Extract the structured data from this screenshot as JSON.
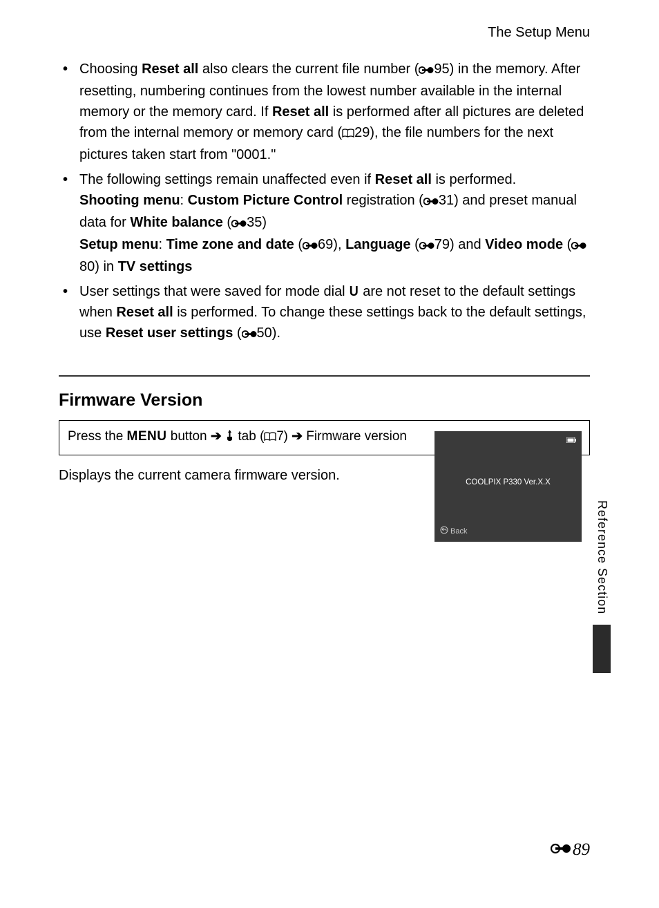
{
  "header": {
    "title": "The Setup Menu"
  },
  "bullets": [
    {
      "parts": [
        {
          "t": "Choosing "
        },
        {
          "t": "Reset all",
          "b": true
        },
        {
          "t": " also clears the current file number ("
        },
        {
          "icon": "reel"
        },
        {
          "t": "95) in the memory. After resetting, numbering continues from the lowest number available in the internal memory or the memory card. If "
        },
        {
          "t": "Reset all",
          "b": true
        },
        {
          "t": " is performed after all pictures are deleted from the internal memory or memory card ("
        },
        {
          "icon": "book"
        },
        {
          "t": "29), the file numbers for the next pictures taken start from \"0001.\""
        }
      ]
    },
    {
      "parts": [
        {
          "t": "The following settings remain unaffected even if "
        },
        {
          "t": "Reset all",
          "b": true
        },
        {
          "t": " is performed."
        },
        {
          "br": true
        },
        {
          "t": "Shooting menu",
          "b": true
        },
        {
          "t": ": "
        },
        {
          "t": "Custom Picture Control",
          "b": true
        },
        {
          "t": " registration ("
        },
        {
          "icon": "reel"
        },
        {
          "t": "31) and preset manual data for "
        },
        {
          "t": "White balance",
          "b": true
        },
        {
          "t": " ("
        },
        {
          "icon": "reel"
        },
        {
          "t": "35)"
        },
        {
          "br": true
        },
        {
          "t": "Setup menu",
          "b": true
        },
        {
          "t": ": "
        },
        {
          "t": "Time zone and date",
          "b": true
        },
        {
          "t": " ("
        },
        {
          "icon": "reel"
        },
        {
          "t": "69), "
        },
        {
          "t": "Language",
          "b": true
        },
        {
          "t": " ("
        },
        {
          "icon": "reel"
        },
        {
          "t": "79) and "
        },
        {
          "t": "Video mode",
          "b": true
        },
        {
          "t": " ("
        },
        {
          "icon": "reel"
        },
        {
          "t": "80) in "
        },
        {
          "t": "TV settings",
          "b": true
        }
      ]
    },
    {
      "parts": [
        {
          "t": "User settings that were saved for mode dial "
        },
        {
          "modedial": "U"
        },
        {
          "t": " are not reset to the default settings when "
        },
        {
          "t": "Reset all",
          "b": true
        },
        {
          "t": " is performed. To change these settings back to the default settings, use "
        },
        {
          "t": "Reset user settings",
          "b": true
        },
        {
          "t": " ("
        },
        {
          "icon": "reel"
        },
        {
          "t": "50)."
        }
      ]
    }
  ],
  "section": {
    "title": "Firmware Version",
    "nav_prefix": "Press the ",
    "nav_menu_label": "MENU",
    "nav_button_word": " button ",
    "nav_tab_word": " tab (",
    "nav_ref": "7",
    "nav_close": ") ",
    "nav_target": " Firmware version",
    "description": "Displays the current camera firmware version."
  },
  "lcd": {
    "model_line": "COOLPIX P330 Ver.X.X",
    "back_label": "Back"
  },
  "side_label": "Reference Section",
  "page_number": "89"
}
